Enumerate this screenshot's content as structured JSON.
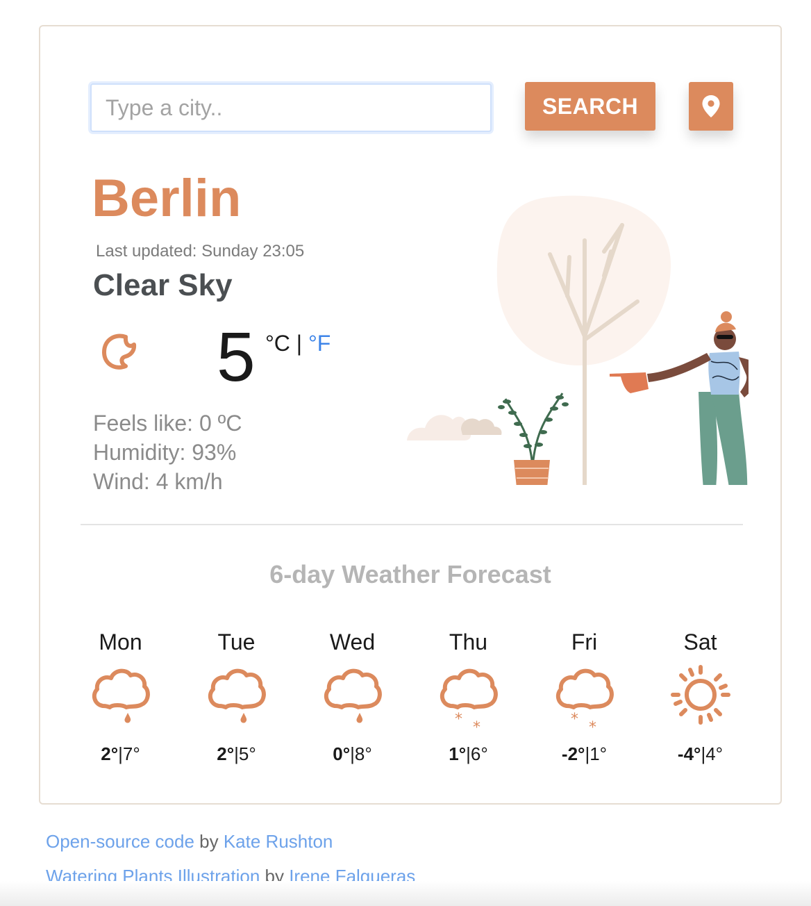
{
  "search": {
    "placeholder": "Type a city..",
    "button_label": "SEARCH",
    "location_icon": "map-pin-icon"
  },
  "current": {
    "city": "Berlin",
    "last_updated": "Last updated: Sunday 23:05",
    "description": "Clear Sky",
    "icon": "moon-icon",
    "temperature": "5",
    "unit_celsius": "°C",
    "unit_separator": "|",
    "unit_fahrenheit": "°F",
    "feels_like": "Feels like: 0 ºC",
    "humidity": "Humidity: 93%",
    "wind": "Wind: 4 km/h"
  },
  "forecast": {
    "title": "6-day Weather Forecast",
    "days": [
      {
        "day": "Mon",
        "icon": "rain-cloud-icon",
        "min": "2°",
        "max": "7°"
      },
      {
        "day": "Tue",
        "icon": "rain-cloud-icon",
        "min": "2°",
        "max": "5°"
      },
      {
        "day": "Wed",
        "icon": "rain-cloud-icon",
        "min": "0°",
        "max": "8°"
      },
      {
        "day": "Thu",
        "icon": "snow-cloud-icon",
        "min": "1°",
        "max": "6°"
      },
      {
        "day": "Fri",
        "icon": "snow-cloud-icon",
        "min": "-2°",
        "max": "1°"
      },
      {
        "day": "Sat",
        "icon": "sun-icon",
        "min": "-4°",
        "max": "4°"
      }
    ]
  },
  "credits": {
    "code_link": "Open-source code",
    "code_by": " by ",
    "code_author": "Kate Rushton",
    "illustration_link": "Watering Plants Illustration",
    "illustration_by": " by ",
    "illustration_author": "Irene Falgueras"
  },
  "colors": {
    "accent": "#dc8a5d",
    "link": "#6da2ea",
    "fahrenheit": "#3d84e8"
  }
}
